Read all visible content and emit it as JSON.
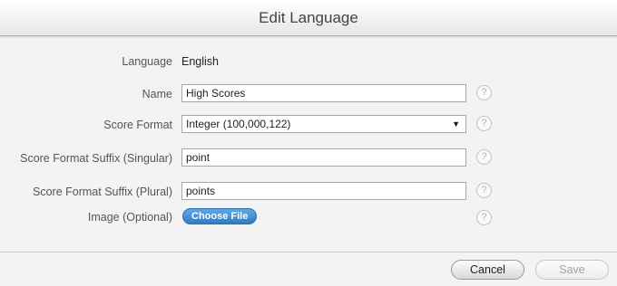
{
  "dialog": {
    "title": "Edit Language"
  },
  "form": {
    "language": {
      "label": "Language",
      "value": "English"
    },
    "name": {
      "label": "Name",
      "value": "High Scores"
    },
    "score_format": {
      "label": "Score Format",
      "value": "Integer (100,000,122)"
    },
    "suffix_singular": {
      "label": "Score Format Suffix (Singular)",
      "value": "point"
    },
    "suffix_plural": {
      "label": "Score Format Suffix (Plural)",
      "value": "points"
    },
    "image": {
      "label": "Image (Optional)",
      "button_label": "Choose File"
    },
    "help_glyph": "?"
  },
  "footer": {
    "cancel_label": "Cancel",
    "save_label": "Save"
  }
}
